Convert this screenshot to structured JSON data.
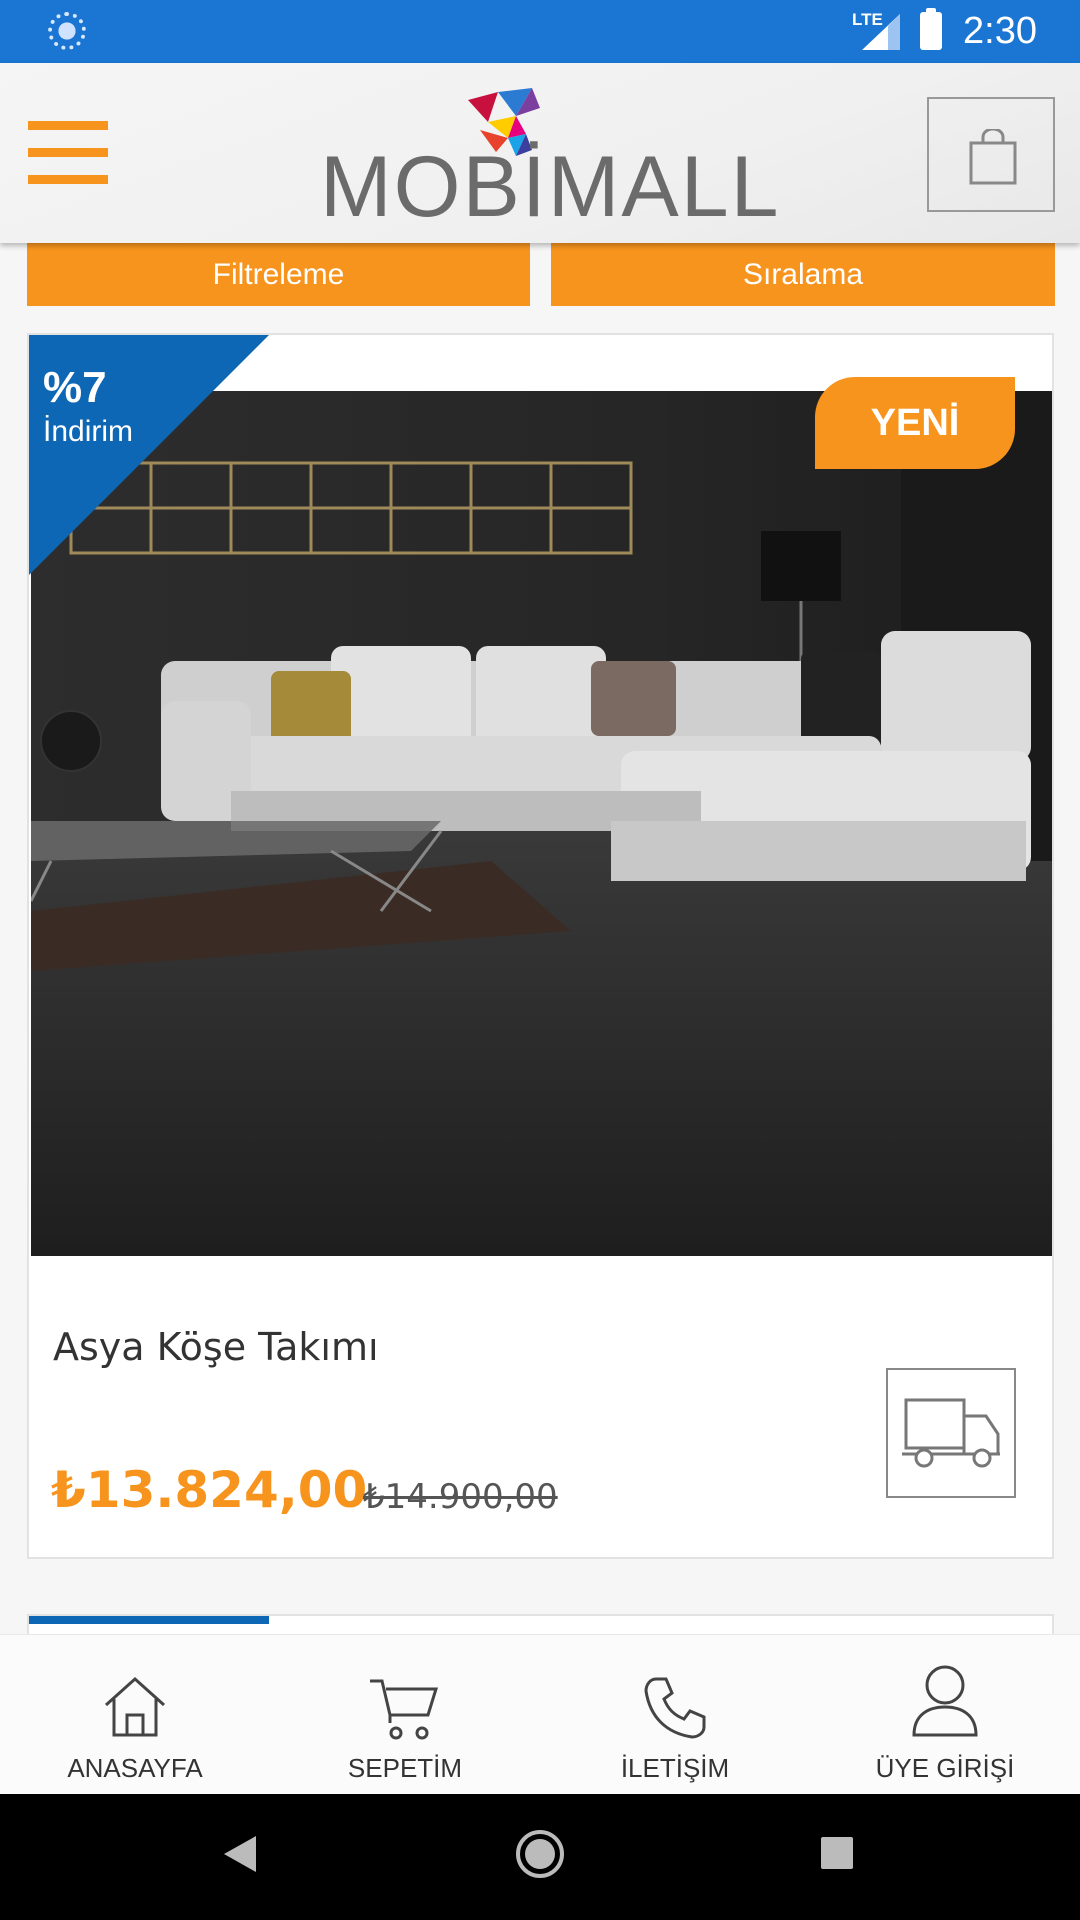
{
  "status_bar": {
    "network": "LTE",
    "time": "2:30"
  },
  "header": {
    "logo_text": "MOBİMALL"
  },
  "filters": {
    "filter_label": "Filtreleme",
    "sort_label": "Sıralama"
  },
  "product": {
    "discount_percent": "%7",
    "discount_label": "İndirim",
    "badge": "YENİ",
    "name": "Asya Köşe Takımı",
    "price": "₺13.824,00",
    "old_price": "₺14.900,00"
  },
  "bottom_nav": [
    {
      "label": "ANASAYFA",
      "icon": "home-icon"
    },
    {
      "label": "SEPETİM",
      "icon": "cart-icon"
    },
    {
      "label": "İLETİŞİM",
      "icon": "phone-icon"
    },
    {
      "label": "ÜYE GİRİŞİ",
      "icon": "user-icon"
    }
  ],
  "colors": {
    "accent": "#f7941d",
    "status_bar": "#1a76d2",
    "discount": "#0e67b4"
  }
}
